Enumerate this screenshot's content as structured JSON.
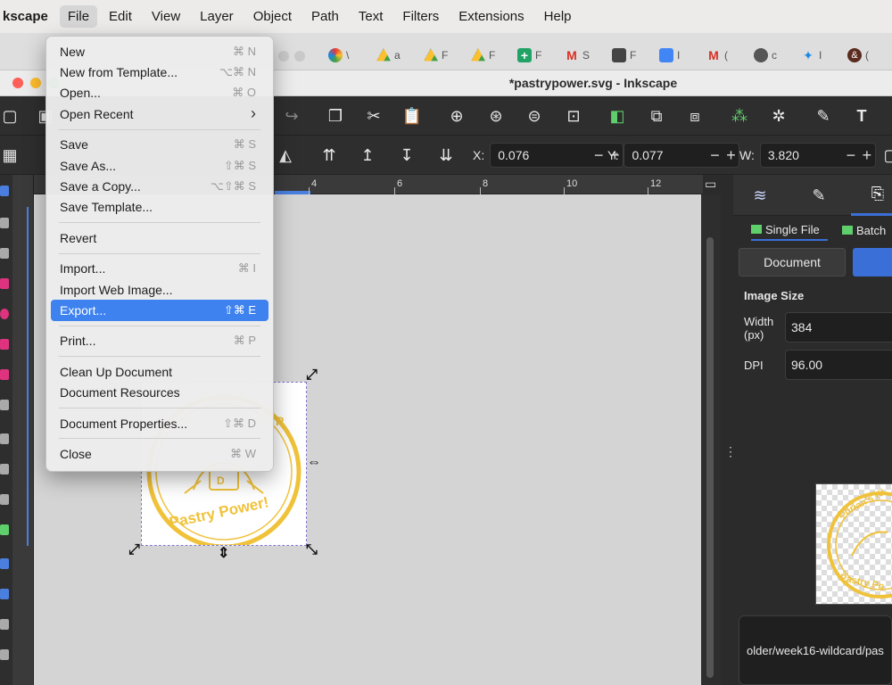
{
  "menubar": {
    "app_name": "kscape",
    "items": [
      "File",
      "Edit",
      "View",
      "Layer",
      "Object",
      "Path",
      "Text",
      "Filters",
      "Extensions",
      "Help"
    ]
  },
  "browser_tabs": [
    {
      "label": "\\",
      "icon": "color-wheel-icon"
    },
    {
      "label": "a",
      "icon": "drive-icon"
    },
    {
      "label": "F",
      "icon": "drive-icon"
    },
    {
      "label": "F",
      "icon": "drive-icon"
    },
    {
      "label": "F",
      "icon": "sheets-icon"
    },
    {
      "label": "S",
      "icon": "gmail-icon"
    },
    {
      "label": "F",
      "icon": "contacts-icon"
    },
    {
      "label": "I",
      "icon": "docs-icon"
    },
    {
      "label": "(",
      "icon": "gmail-icon"
    },
    {
      "label": "c",
      "icon": "globe-icon"
    },
    {
      "label": "I",
      "icon": "magic-wand-icon"
    },
    {
      "label": "(",
      "icon": "ampersand-icon"
    }
  ],
  "window": {
    "title": "*pastrypower.svg - Inkscape"
  },
  "toolbar": {
    "x_label": "X:",
    "x_value": "0.076",
    "y_label": "Y:",
    "y_value": "0.077",
    "w_label": "W:",
    "w_value": "3.820",
    "minus": "−",
    "plus": "+"
  },
  "ruler": {
    "labels": [
      "4",
      "6",
      "8",
      "10",
      "12"
    ]
  },
  "dock": {
    "tabs": [
      "layers-icon",
      "xml-editor-icon",
      "export-icon"
    ],
    "single_file": "Single File",
    "batch": "Batch",
    "document_btn": "Document",
    "image_size_heading": "Image Size",
    "width_label": "Width\n(px)",
    "width_value": "384",
    "dpi_label": "DPI",
    "dpi_value": "96.00",
    "path_text": "older/week16-wildcard/pas"
  },
  "artwork": {
    "caption": "Pastry Power!",
    "preview_caption_top": "Dorian's Ki",
    "preview_caption_bottom": "Pastry Po",
    "accent": "#f0c23a"
  },
  "file_menu": {
    "groups": [
      [
        {
          "label": "New",
          "shortcut": "⌘ N"
        },
        {
          "label": "New from Template...",
          "shortcut": "⌥⌘ N"
        },
        {
          "label": "Open...",
          "shortcut": "⌘ O"
        },
        {
          "label": "Open Recent",
          "shortcut": "›"
        }
      ],
      [
        {
          "label": "Save",
          "shortcut": "⌘ S"
        },
        {
          "label": "Save As...",
          "shortcut": "⇧⌘ S"
        },
        {
          "label": "Save a Copy...",
          "shortcut": "⌥⇧⌘ S"
        },
        {
          "label": "Save Template...",
          "shortcut": ""
        }
      ],
      [
        {
          "label": "Revert",
          "shortcut": ""
        }
      ],
      [
        {
          "label": "Import...",
          "shortcut": "⌘ I"
        },
        {
          "label": "Import Web Image...",
          "shortcut": ""
        },
        {
          "label": "Export...",
          "shortcut": "⇧⌘ E",
          "highlighted": true
        }
      ],
      [
        {
          "label": "Print...",
          "shortcut": "⌘ P"
        }
      ],
      [
        {
          "label": "Clean Up Document",
          "shortcut": ""
        },
        {
          "label": "Document Resources",
          "shortcut": ""
        }
      ],
      [
        {
          "label": "Document Properties...",
          "shortcut": "⇧⌘ D"
        }
      ],
      [
        {
          "label": "Close",
          "shortcut": "⌘ W"
        }
      ]
    ]
  },
  "colors": {
    "highlight": "#3e82ef",
    "dock_accent": "#3a6fd8",
    "selection_dash": "#7f78c9"
  }
}
